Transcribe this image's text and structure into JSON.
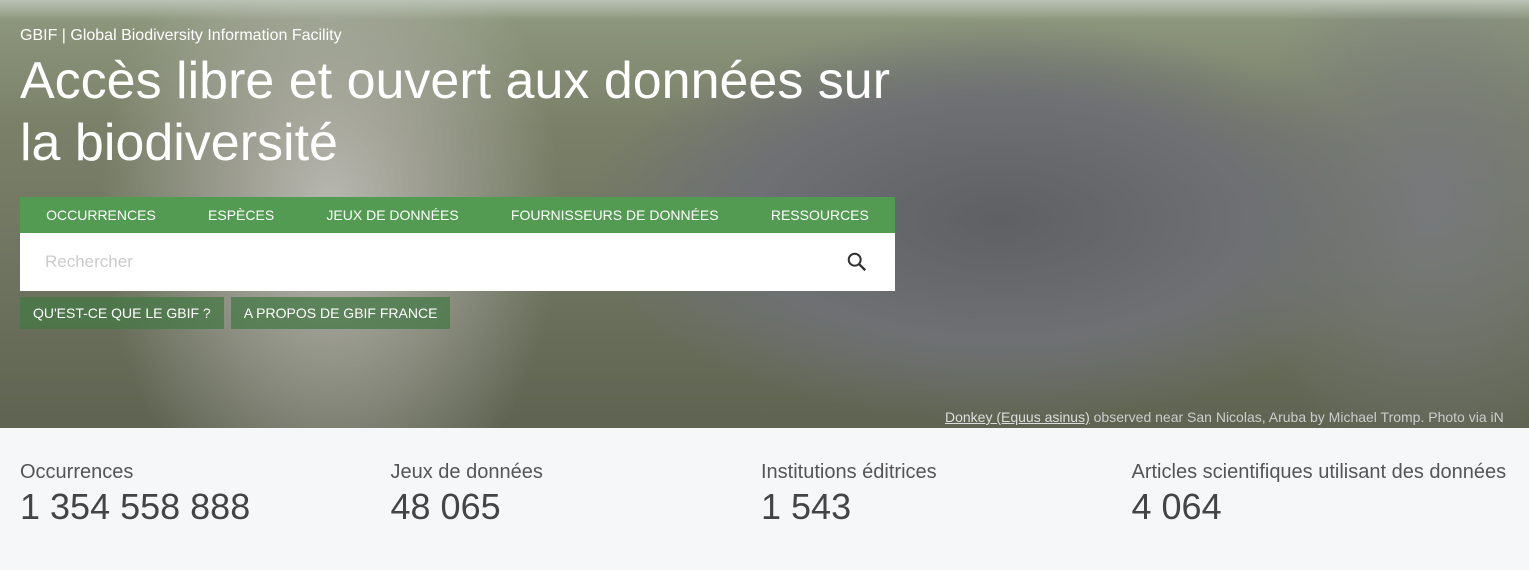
{
  "header": {
    "site_name": "GBIF | Global Biodiversity Information Facility",
    "title": "Accès libre et ouvert aux données sur la biodiversité"
  },
  "nav": [
    "OCCURRENCES",
    "ESPÈCES",
    "JEUX DE DONNÉES",
    "FOURNISSEURS DE DONNÉES",
    "RESSOURCES"
  ],
  "search": {
    "placeholder": "Rechercher",
    "icon": "search-icon"
  },
  "buttons": [
    "QU'EST-CE QUE LE GBIF ?",
    "A PROPOS DE GBIF FRANCE"
  ],
  "caption": {
    "link": "Donkey (Equus asinus)",
    "text": " observed near San Nicolas, Aruba by Michael Tromp. Photo via iN"
  },
  "stats": [
    {
      "label": "Occurrences",
      "value": "1 354 558 888"
    },
    {
      "label": "Jeux de données",
      "value": "48 065"
    },
    {
      "label": "Institutions éditrices",
      "value": "1 543"
    },
    {
      "label": "Articles scientifiques utilisant des données",
      "value": "4 064"
    }
  ]
}
